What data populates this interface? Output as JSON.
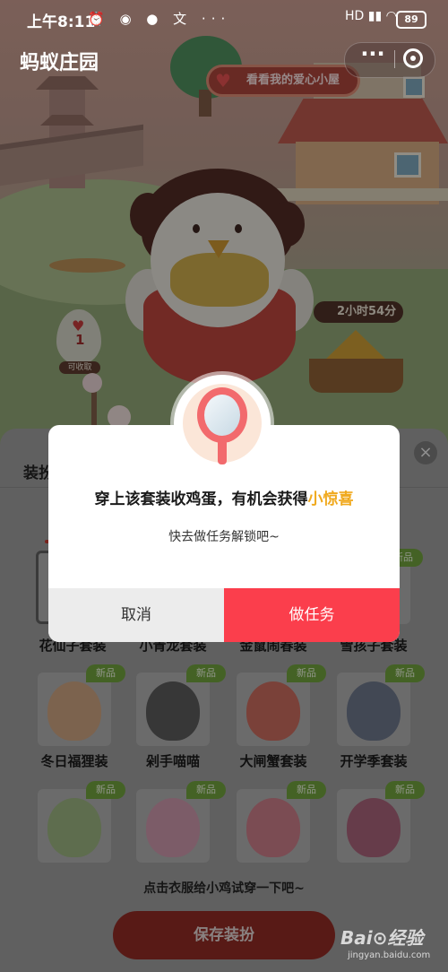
{
  "status_bar": {
    "time": "上午8:11",
    "left_icons": "⏰ ◉ ● 文 ···",
    "right_icons": "HD ▮▮ ◠",
    "battery": "89"
  },
  "header": {
    "title": "蚂蚁庄园",
    "more_label": "···"
  },
  "scene": {
    "love_house_label": "看看我的爱心小屋",
    "egg_count": "1",
    "egg_label": "可收取",
    "timer": "2小时54分"
  },
  "sheet": {
    "title": "装扮",
    "close_label": "×",
    "badge_label": "新品",
    "row1": [
      {
        "label": "花仙子套装"
      },
      {
        "label": "小青龙套装"
      },
      {
        "label": "金鼠闹春装"
      },
      {
        "label": "雪孩子套装"
      }
    ],
    "row2": [
      {
        "label": "冬日福狸装",
        "color": "#b5845f"
      },
      {
        "label": "剁手喵喵",
        "color": "#3d3d3d"
      },
      {
        "label": "大闸蟹套装",
        "color": "#b8443d"
      },
      {
        "label": "开学季套装",
        "color": "#3b4a66"
      }
    ],
    "row3": [
      {
        "color": "#7ea05a"
      },
      {
        "color": "#c76a8e"
      },
      {
        "color": "#c2445a"
      },
      {
        "color": "#8a3a55"
      }
    ],
    "hint": "点击衣服给小鸡试穿一下吧~",
    "save_label": "保存装扮"
  },
  "modal": {
    "title_prefix": "穿上该套装收鸡蛋，有机会获得",
    "title_highlight": "小惊喜",
    "subtitle": "快去做任务解锁吧~",
    "cancel_label": "取消",
    "confirm_label": "做任务"
  },
  "watermark": {
    "brand": "Bai⊙经验",
    "url": "jingyan.baidu.com"
  },
  "colors": {
    "accent_red": "#fb3e4c",
    "highlight_orange": "#f0a91d",
    "badge_green": "#6f9e3c"
  }
}
